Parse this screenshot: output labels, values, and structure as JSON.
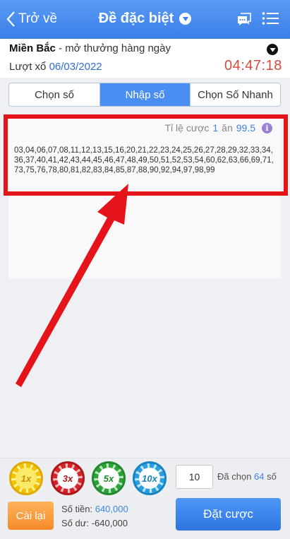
{
  "header": {
    "back_label": "Trở về",
    "title": "Đề đặc biệt"
  },
  "info": {
    "region": "Miền Bắc",
    "region_sub": " - mở thưởng hàng ngày",
    "draw_label": "Lượt xổ ",
    "draw_date": "06/03/2022",
    "countdown": "04:47:18"
  },
  "tabs": [
    {
      "label": "Chọn số",
      "active": false
    },
    {
      "label": "Nhập số",
      "active": true
    },
    {
      "label": "Chọn Số Nhanh",
      "active": false
    }
  ],
  "odds": {
    "label": "Tỉ lệ cược",
    "stake": "1",
    "word": "ăn",
    "payout": "99.5",
    "info_glyph": "i"
  },
  "numbers_text": "03,04,06,07,08,11,12,13,15,16,20,21,22,23,24,25,26,27,28,29,32,33,34,36,37,40,41,42,43,44,45,46,47,48,49,50,51,52,53,54,60,62,63,66,69,71,73,75,76,78,80,81,82,83,84,85,87,88,90,92,94,97,98,99",
  "chips": [
    {
      "label": "1x"
    },
    {
      "label": "3x"
    },
    {
      "label": "5x"
    },
    {
      "label": "10x"
    }
  ],
  "quantity": "10",
  "selected": {
    "prefix": "Đã chọn",
    "count": "64",
    "suffix": "số"
  },
  "footer": {
    "reset_label": "Cài lại",
    "amount_label": "Số tiền:",
    "amount_value": "640,000",
    "balance_label": "Số dư:",
    "balance_value": "-640,000",
    "place_bet_label": "Đặt cược"
  },
  "colors": {
    "primary": "#3a7ee8",
    "countdown": "#d24a3e",
    "highlight": "#e5141b",
    "reset": "#f58a2a"
  }
}
